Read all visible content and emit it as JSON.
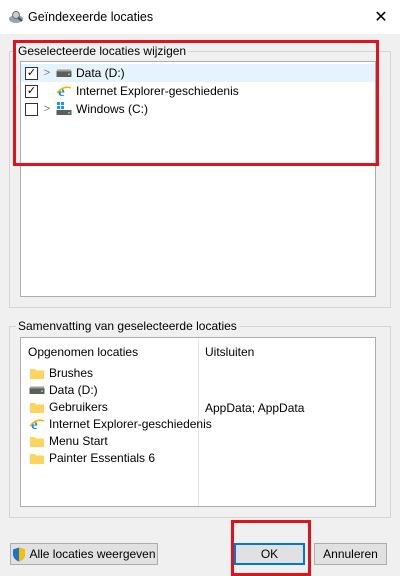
{
  "window": {
    "title": "Geïndexeerde locaties",
    "close_symbol": "✕"
  },
  "selected_group": {
    "label": "Geselecteerde locaties wijzigen",
    "items": [
      {
        "label": "Data (D:)",
        "checked": true,
        "icon": "drive-icon"
      },
      {
        "label": "Internet Explorer-geschiedenis",
        "checked": true,
        "icon": "ie-icon"
      },
      {
        "label": "Windows (C:)",
        "checked": false,
        "icon": "windows-drive-icon"
      }
    ]
  },
  "summary_group": {
    "label": "Samenvatting van geselecteerde locaties",
    "col_included": "Opgenomen locaties",
    "col_excluded": "Uitsluiten",
    "rows": [
      {
        "name": "Brushes",
        "exclude": "",
        "icon": "folder-icon"
      },
      {
        "name": "Data (D:)",
        "exclude": "",
        "icon": "drive-icon"
      },
      {
        "name": "Gebruikers",
        "exclude": "AppData; AppData",
        "icon": "folder-icon"
      },
      {
        "name": "Internet Explorer-geschiedenis",
        "exclude": "",
        "icon": "ie-icon"
      },
      {
        "name": "Menu Start",
        "exclude": "",
        "icon": "folder-icon"
      },
      {
        "name": "Painter Essentials 6",
        "exclude": "",
        "icon": "folder-icon"
      }
    ]
  },
  "buttons": {
    "show_all": "Alle locaties weergeven",
    "ok": "OK",
    "cancel": "Annuleren"
  },
  "colors": {
    "highlight": "#e0121c",
    "selection": "#e5f3ff",
    "accent": "#0078d7"
  }
}
